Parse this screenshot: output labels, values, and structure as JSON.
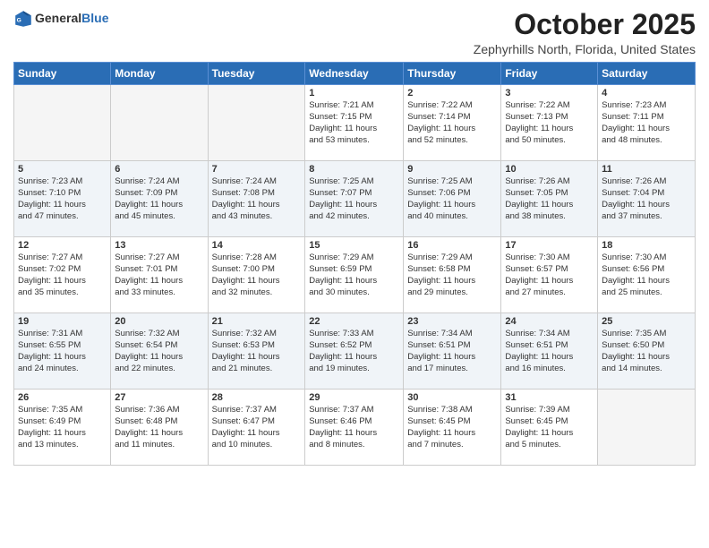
{
  "header": {
    "logo_general": "General",
    "logo_blue": "Blue",
    "month": "October 2025",
    "location": "Zephyrhills North, Florida, United States"
  },
  "days_of_week": [
    "Sunday",
    "Monday",
    "Tuesday",
    "Wednesday",
    "Thursday",
    "Friday",
    "Saturday"
  ],
  "weeks": [
    [
      {
        "day": "",
        "info": ""
      },
      {
        "day": "",
        "info": ""
      },
      {
        "day": "",
        "info": ""
      },
      {
        "day": "1",
        "info": "Sunrise: 7:21 AM\nSunset: 7:15 PM\nDaylight: 11 hours\nand 53 minutes."
      },
      {
        "day": "2",
        "info": "Sunrise: 7:22 AM\nSunset: 7:14 PM\nDaylight: 11 hours\nand 52 minutes."
      },
      {
        "day": "3",
        "info": "Sunrise: 7:22 AM\nSunset: 7:13 PM\nDaylight: 11 hours\nand 50 minutes."
      },
      {
        "day": "4",
        "info": "Sunrise: 7:23 AM\nSunset: 7:11 PM\nDaylight: 11 hours\nand 48 minutes."
      }
    ],
    [
      {
        "day": "5",
        "info": "Sunrise: 7:23 AM\nSunset: 7:10 PM\nDaylight: 11 hours\nand 47 minutes."
      },
      {
        "day": "6",
        "info": "Sunrise: 7:24 AM\nSunset: 7:09 PM\nDaylight: 11 hours\nand 45 minutes."
      },
      {
        "day": "7",
        "info": "Sunrise: 7:24 AM\nSunset: 7:08 PM\nDaylight: 11 hours\nand 43 minutes."
      },
      {
        "day": "8",
        "info": "Sunrise: 7:25 AM\nSunset: 7:07 PM\nDaylight: 11 hours\nand 42 minutes."
      },
      {
        "day": "9",
        "info": "Sunrise: 7:25 AM\nSunset: 7:06 PM\nDaylight: 11 hours\nand 40 minutes."
      },
      {
        "day": "10",
        "info": "Sunrise: 7:26 AM\nSunset: 7:05 PM\nDaylight: 11 hours\nand 38 minutes."
      },
      {
        "day": "11",
        "info": "Sunrise: 7:26 AM\nSunset: 7:04 PM\nDaylight: 11 hours\nand 37 minutes."
      }
    ],
    [
      {
        "day": "12",
        "info": "Sunrise: 7:27 AM\nSunset: 7:02 PM\nDaylight: 11 hours\nand 35 minutes."
      },
      {
        "day": "13",
        "info": "Sunrise: 7:27 AM\nSunset: 7:01 PM\nDaylight: 11 hours\nand 33 minutes."
      },
      {
        "day": "14",
        "info": "Sunrise: 7:28 AM\nSunset: 7:00 PM\nDaylight: 11 hours\nand 32 minutes."
      },
      {
        "day": "15",
        "info": "Sunrise: 7:29 AM\nSunset: 6:59 PM\nDaylight: 11 hours\nand 30 minutes."
      },
      {
        "day": "16",
        "info": "Sunrise: 7:29 AM\nSunset: 6:58 PM\nDaylight: 11 hours\nand 29 minutes."
      },
      {
        "day": "17",
        "info": "Sunrise: 7:30 AM\nSunset: 6:57 PM\nDaylight: 11 hours\nand 27 minutes."
      },
      {
        "day": "18",
        "info": "Sunrise: 7:30 AM\nSunset: 6:56 PM\nDaylight: 11 hours\nand 25 minutes."
      }
    ],
    [
      {
        "day": "19",
        "info": "Sunrise: 7:31 AM\nSunset: 6:55 PM\nDaylight: 11 hours\nand 24 minutes."
      },
      {
        "day": "20",
        "info": "Sunrise: 7:32 AM\nSunset: 6:54 PM\nDaylight: 11 hours\nand 22 minutes."
      },
      {
        "day": "21",
        "info": "Sunrise: 7:32 AM\nSunset: 6:53 PM\nDaylight: 11 hours\nand 21 minutes."
      },
      {
        "day": "22",
        "info": "Sunrise: 7:33 AM\nSunset: 6:52 PM\nDaylight: 11 hours\nand 19 minutes."
      },
      {
        "day": "23",
        "info": "Sunrise: 7:34 AM\nSunset: 6:51 PM\nDaylight: 11 hours\nand 17 minutes."
      },
      {
        "day": "24",
        "info": "Sunrise: 7:34 AM\nSunset: 6:51 PM\nDaylight: 11 hours\nand 16 minutes."
      },
      {
        "day": "25",
        "info": "Sunrise: 7:35 AM\nSunset: 6:50 PM\nDaylight: 11 hours\nand 14 minutes."
      }
    ],
    [
      {
        "day": "26",
        "info": "Sunrise: 7:35 AM\nSunset: 6:49 PM\nDaylight: 11 hours\nand 13 minutes."
      },
      {
        "day": "27",
        "info": "Sunrise: 7:36 AM\nSunset: 6:48 PM\nDaylight: 11 hours\nand 11 minutes."
      },
      {
        "day": "28",
        "info": "Sunrise: 7:37 AM\nSunset: 6:47 PM\nDaylight: 11 hours\nand 10 minutes."
      },
      {
        "day": "29",
        "info": "Sunrise: 7:37 AM\nSunset: 6:46 PM\nDaylight: 11 hours\nand 8 minutes."
      },
      {
        "day": "30",
        "info": "Sunrise: 7:38 AM\nSunset: 6:45 PM\nDaylight: 11 hours\nand 7 minutes."
      },
      {
        "day": "31",
        "info": "Sunrise: 7:39 AM\nSunset: 6:45 PM\nDaylight: 11 hours\nand 5 minutes."
      },
      {
        "day": "",
        "info": ""
      }
    ]
  ]
}
